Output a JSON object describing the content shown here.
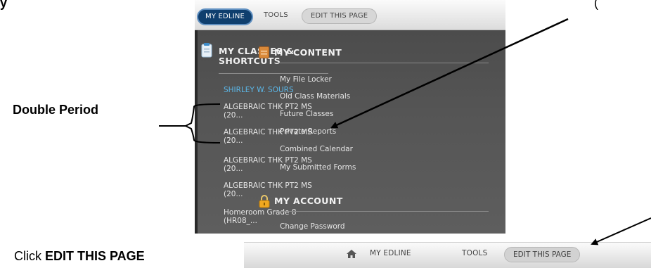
{
  "annotations": {
    "top_left": "y",
    "top_right": "(",
    "double_period": "Double Period",
    "click_prefix": "Click ",
    "click_bold": "EDIT THIS PAGE"
  },
  "screenshot1": {
    "topbar": {
      "my_edline": "MY EDLINE",
      "tools": "TOOLS",
      "edit_this_page": "EDIT THIS PAGE"
    },
    "classes": {
      "title_line1": "MY CLASSES &",
      "title_line2": "SHORTCUTS",
      "user_name": "SHIRLEY W. SOURS",
      "items": [
        {
          "line1": "ALGEBRAIC THK PT2 MS",
          "line2": "(20..."
        },
        {
          "line1": "ALGEBRAIC THK PT2 MS",
          "line2": "(20..."
        },
        {
          "line1": "ALGEBRAIC THK PT2 MS",
          "line2": "(20..."
        },
        {
          "line1": "ALGEBRAIC THK PT2 MS",
          "line2": "(20..."
        },
        {
          "line1": "Homeroom Grade 8",
          "line2": "(HR08_..."
        }
      ]
    },
    "content": {
      "title": "MY CONTENT",
      "items": [
        "My File Locker",
        "Old Class Materials",
        "Future Classes",
        "Private Reports",
        "Combined Calendar",
        "My Submitted Forms"
      ]
    },
    "account": {
      "title": "MY ACCOUNT",
      "items": [
        "Change Password"
      ]
    }
  },
  "screenshot2": {
    "my_edline": "MY EDLINE",
    "tools": "TOOLS",
    "edit_this_page": "EDIT THIS PAGE"
  },
  "icons": {
    "classes": "document-icon",
    "content": "folder-icon",
    "account": "lock-icon",
    "home": "home-icon"
  },
  "colors": {
    "panel": "#555555",
    "active_pill": "#0f3f6e",
    "user_name": "#5bb7e8",
    "content_icon": "#d9893a",
    "lock_icon": "#f0a820"
  }
}
